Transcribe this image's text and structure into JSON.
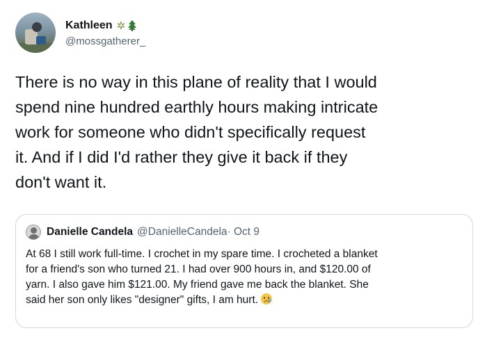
{
  "author": {
    "display_name": "Kathleen",
    "handle": "@mossgatherer_",
    "name_emojis": [
      "herb",
      "evergreen-tree"
    ]
  },
  "tweet": {
    "lines": [
      "There is no way in this plane of reality that I would",
      "spend nine hundred earthly hours making intricate",
      "work for someone who didn't specifically request",
      "it. And if I did I'd rather they give it back if they",
      "don't want it."
    ]
  },
  "quote": {
    "display_name": "Danielle Candela",
    "handle": "@DanielleCandela",
    "date": "· Oct 9",
    "lines": [
      "At 68 I still work full-time. I crochet in my spare time. I crocheted a blanket",
      "for a friend's son who turned 21. I had over 900 hours in, and $120.00 of",
      "yarn. I also gave him $121.00. My friend gave me back the blanket. She",
      "said her son only likes \"designer\" gifts, I am hurt."
    ],
    "trailing_emoji": "crying-face"
  },
  "colors": {
    "text": "#0f1419",
    "secondary": "#536471",
    "border": "#cfd9de"
  }
}
